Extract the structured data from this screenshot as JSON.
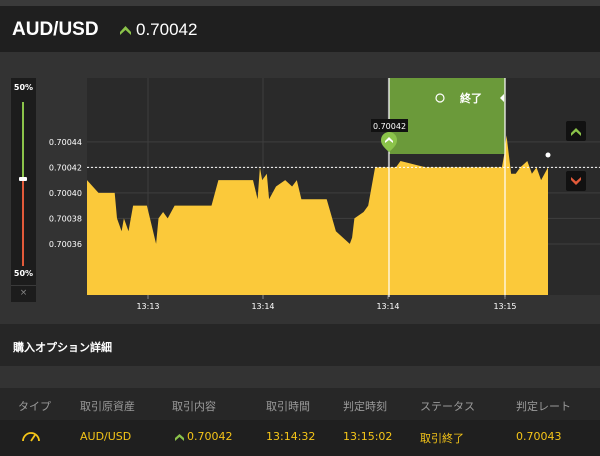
{
  "header": {
    "symbol": "AUD/USD",
    "rate": "0.70042"
  },
  "gauge": {
    "top_label": "50%",
    "bottom_label": "50%",
    "close_label": "×"
  },
  "chart": {
    "expiry_label": "終了",
    "current_rate_tag": "0.70042",
    "colors": {
      "area": "#fbc93a",
      "expiry_zone": "#6b9a3a",
      "grid": "#3f3f3f",
      "up": "#8bc34a",
      "down": "#e25a3a"
    }
  },
  "chart_data": {
    "type": "area",
    "y_ticks": [
      "0.70044",
      "0.70042",
      "0.70040",
      "0.70038",
      "0.70036"
    ],
    "x_ticks": [
      "13:13",
      "13:14",
      "13:14",
      "13:15"
    ],
    "ylim": [
      0.70032,
      0.70049
    ],
    "grid": true,
    "points": [
      [
        0,
        0.70041
      ],
      [
        0.025,
        0.7004
      ],
      [
        0.06,
        0.7004
      ],
      [
        0.065,
        0.70038
      ],
      [
        0.075,
        0.70037
      ],
      [
        0.08,
        0.70038
      ],
      [
        0.09,
        0.70037
      ],
      [
        0.1,
        0.70039
      ],
      [
        0.13,
        0.70039
      ],
      [
        0.14,
        0.700375
      ],
      [
        0.15,
        0.70036
      ],
      [
        0.155,
        0.70038
      ],
      [
        0.165,
        0.700385
      ],
      [
        0.175,
        0.70038
      ],
      [
        0.19,
        0.70039
      ],
      [
        0.27,
        0.70039
      ],
      [
        0.285,
        0.70041
      ],
      [
        0.36,
        0.70041
      ],
      [
        0.37,
        0.700395
      ],
      [
        0.375,
        0.70042
      ],
      [
        0.38,
        0.70041
      ],
      [
        0.39,
        0.700415
      ],
      [
        0.395,
        0.700395
      ],
      [
        0.41,
        0.700405
      ],
      [
        0.43,
        0.70041
      ],
      [
        0.445,
        0.700405
      ],
      [
        0.455,
        0.70041
      ],
      [
        0.465,
        0.700395
      ],
      [
        0.52,
        0.700395
      ],
      [
        0.54,
        0.70037
      ],
      [
        0.555,
        0.700365
      ],
      [
        0.57,
        0.70036
      ],
      [
        0.575,
        0.700365
      ],
      [
        0.58,
        0.70038
      ],
      [
        0.6,
        0.700385
      ],
      [
        0.61,
        0.70039
      ],
      [
        0.625,
        0.70042
      ],
      [
        0.67,
        0.70042
      ],
      [
        0.68,
        0.700425
      ],
      [
        0.735,
        0.70042
      ],
      [
        0.775,
        0.70042
      ],
      [
        0.85,
        0.70042
      ],
      [
        0.9,
        0.70042
      ],
      [
        0.905,
        0.70043
      ],
      [
        0.91,
        0.700445
      ],
      [
        0.92,
        0.700415
      ],
      [
        0.93,
        0.700415
      ],
      [
        0.94,
        0.70042
      ],
      [
        0.955,
        0.700425
      ],
      [
        0.965,
        0.700415
      ],
      [
        0.975,
        0.70042
      ],
      [
        0.985,
        0.70041
      ],
      [
        1,
        0.70042
      ]
    ],
    "current_rate": 0.70042
  },
  "details": {
    "title": "購入オプション詳細",
    "columns": [
      "タイプ",
      "取引原資産",
      "取引内容",
      "取引時間",
      "判定時刻",
      "ステータス",
      "判定レート"
    ],
    "row": {
      "type_icon": "gauge-icon",
      "asset": "AUD/USD",
      "direction_icon": "up-arrow-icon",
      "rate": "0.70042",
      "trade_time": "13:14:32",
      "judge_time": "13:15:02",
      "status": "取引終了",
      "judge_rate": "0.70043"
    }
  }
}
